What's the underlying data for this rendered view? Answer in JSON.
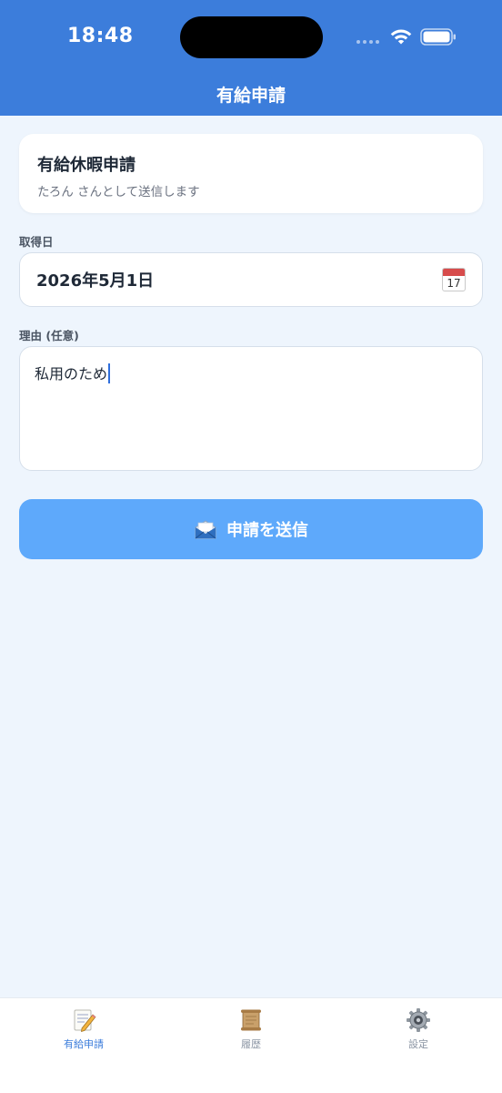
{
  "status_bar": {
    "time": "18:48",
    "icons": [
      "signal-dots-icon",
      "wifi-icon",
      "battery-icon"
    ]
  },
  "nav": {
    "title": "有給申請"
  },
  "card": {
    "title": "有給休暇申請",
    "subtitle": "たろん さんとして送信します"
  },
  "form": {
    "date_label": "取得日",
    "date_value": "2026年5月1日",
    "date_icon": "calendar-icon",
    "calendar_day": "17",
    "reason_label": "理由 (任意)",
    "reason_value": "私用のため"
  },
  "submit": {
    "label": "申請を送信",
    "icon": "envelope-icon"
  },
  "tabs": [
    {
      "label": "有給申請",
      "icon": "memo-icon",
      "active": true
    },
    {
      "label": "履歴",
      "icon": "scroll-icon",
      "active": false
    },
    {
      "label": "設定",
      "icon": "gear-icon",
      "active": false
    }
  ],
  "colors": {
    "header": "#3c7ddb",
    "background": "#eef5fd",
    "button": "#5ea9fb",
    "active_tab": "#3c7ddb",
    "inactive_tab": "#8a94a3"
  }
}
